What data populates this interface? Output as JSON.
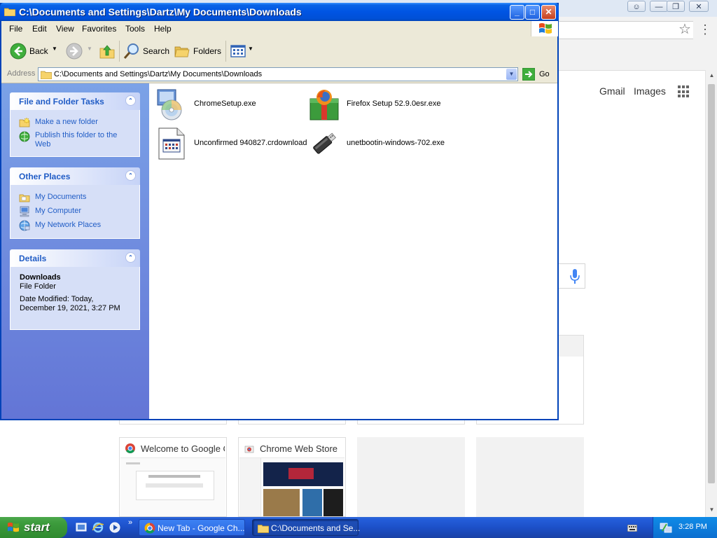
{
  "chrome": {
    "links": {
      "gmail": "Gmail",
      "images": "Images"
    },
    "tiles": [
      {
        "title": "Welcome to Google C"
      },
      {
        "title": "Chrome Web Store"
      }
    ]
  },
  "explorer": {
    "title": "C:\\Documents and Settings\\Dartz\\My Documents\\Downloads",
    "menu": [
      "File",
      "Edit",
      "View",
      "Favorites",
      "Tools",
      "Help"
    ],
    "toolbar": {
      "back": "Back",
      "search": "Search",
      "folders": "Folders"
    },
    "address": {
      "label": "Address",
      "value": "C:\\Documents and Settings\\Dartz\\My Documents\\Downloads",
      "go": "Go"
    },
    "panels": {
      "file_tasks": {
        "title": "File and Folder Tasks",
        "items": [
          "Make a new folder",
          "Publish this folder to the Web"
        ]
      },
      "other_places": {
        "title": "Other Places",
        "items": [
          "My Documents",
          "My Computer",
          "My Network Places"
        ]
      },
      "details": {
        "title": "Details",
        "name": "Downloads",
        "type": "File Folder",
        "modified": "Date Modified: Today, December 19, 2021, 3:27 PM"
      }
    },
    "files": [
      {
        "name": "ChromeSetup.exe",
        "icon": "installer-cd-icon"
      },
      {
        "name": "Firefox Setup 52.9.0esr.exe",
        "icon": "firefox-installer-icon"
      },
      {
        "name": "Unconfirmed 940827.crdownload",
        "icon": "generic-file-icon"
      },
      {
        "name": "unetbootin-windows-702.exe",
        "icon": "usb-drive-icon"
      }
    ]
  },
  "taskbar": {
    "start": "start",
    "tasks": [
      {
        "label": "New Tab - Google Ch..."
      },
      {
        "label": "C:\\Documents and Se..."
      }
    ],
    "clock": "3:28 PM"
  },
  "colors": {
    "xp_blue": "#0054e3",
    "task_pane": "#7ba2e7",
    "link_blue": "#215dc6",
    "start_green": "#3c9b3c"
  }
}
